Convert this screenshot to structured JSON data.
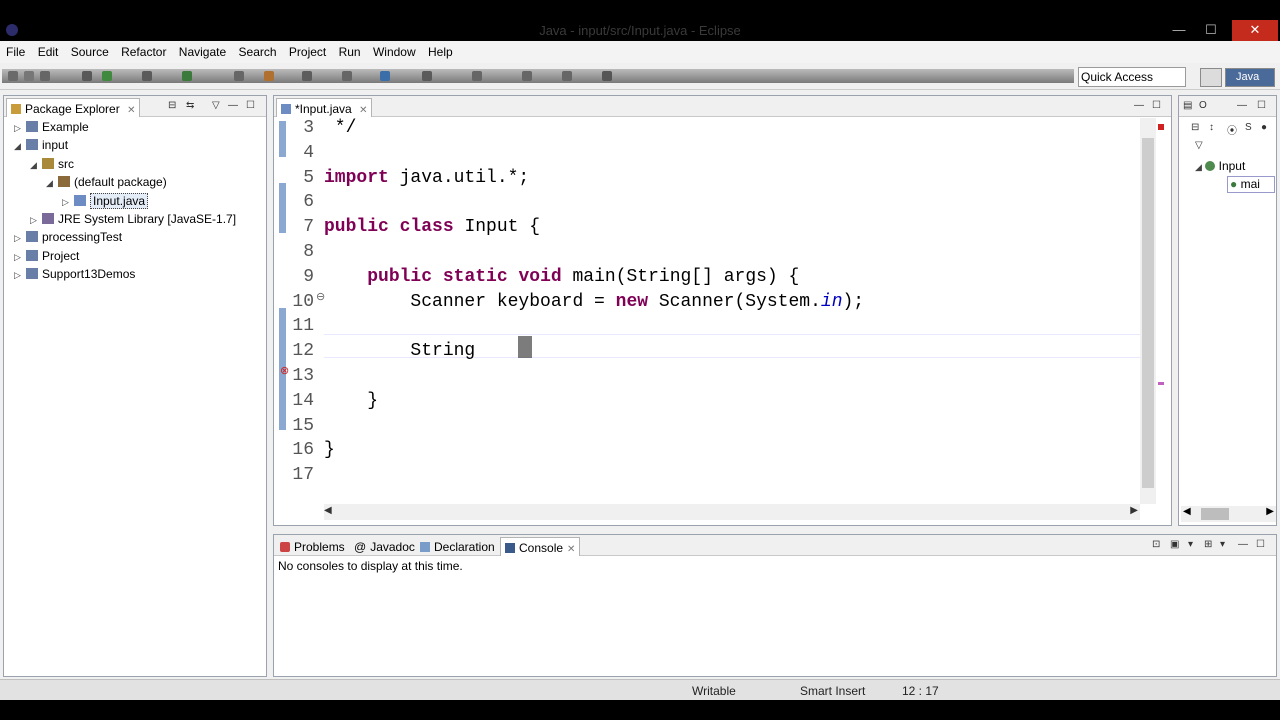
{
  "window": {
    "title": "Java - input/src/Input.java - Eclipse",
    "minimize_glyph": "—",
    "maximize_glyph": "☐",
    "close_glyph": "✕"
  },
  "menu": [
    "File",
    "Edit",
    "Source",
    "Refactor",
    "Navigate",
    "Search",
    "Project",
    "Run",
    "Window",
    "Help"
  ],
  "toolbar": {
    "quick_access_placeholder": "Quick Access",
    "perspective_label": "Java"
  },
  "package_explorer": {
    "tab_label": "Package Explorer",
    "tree": [
      {
        "label": "Example",
        "level": 0,
        "expanded": false,
        "icon": "project-icon"
      },
      {
        "label": "input",
        "level": 0,
        "expanded": true,
        "icon": "project-icon"
      },
      {
        "label": "src",
        "level": 1,
        "expanded": true,
        "icon": "source-folder-icon"
      },
      {
        "label": "(default package)",
        "level": 2,
        "expanded": true,
        "icon": "package-icon"
      },
      {
        "label": "Input.java",
        "level": 3,
        "expanded": false,
        "icon": "java-file-icon",
        "selected": true
      },
      {
        "label": "JRE System Library [JavaSE-1.7]",
        "level": 1,
        "expanded": false,
        "icon": "library-icon"
      },
      {
        "label": "processingTest",
        "level": 0,
        "expanded": false,
        "icon": "project-icon"
      },
      {
        "label": "Project",
        "level": 0,
        "expanded": false,
        "icon": "project-icon"
      },
      {
        "label": "Support13Demos",
        "level": 0,
        "expanded": false,
        "icon": "project-icon"
      }
    ]
  },
  "editor": {
    "tab_label": "*Input.java",
    "lines": [
      {
        "num": "3",
        "text": " */"
      },
      {
        "num": "4",
        "text": ""
      },
      {
        "num": "5",
        "text": "import java.util.*;"
      },
      {
        "num": "6",
        "text": ""
      },
      {
        "num": "7",
        "text": "public class Input {"
      },
      {
        "num": "8",
        "text": ""
      },
      {
        "num": "9",
        "text": "    public static void main(String[] args) {"
      },
      {
        "num": "10",
        "text": "        Scanner keyboard = new Scanner(System.in);"
      },
      {
        "num": "11",
        "text": ""
      },
      {
        "num": "12",
        "text": "        String "
      },
      {
        "num": "13",
        "text": ""
      },
      {
        "num": "14",
        "text": "    }"
      },
      {
        "num": "15",
        "text": ""
      },
      {
        "num": "16",
        "text": "}"
      },
      {
        "num": "17",
        "text": ""
      }
    ],
    "cursor_line": "12",
    "error_line": "12"
  },
  "outline": {
    "items": [
      {
        "label": "Input"
      },
      {
        "label": "mai"
      }
    ]
  },
  "bottom_panel": {
    "tabs": [
      "Problems",
      "Javadoc",
      "Declaration",
      "Console"
    ],
    "active_tab": "Console",
    "message": "No consoles to display at this time."
  },
  "status": {
    "writable": "Writable",
    "insert_mode": "Smart Insert",
    "position": "12 : 17"
  }
}
